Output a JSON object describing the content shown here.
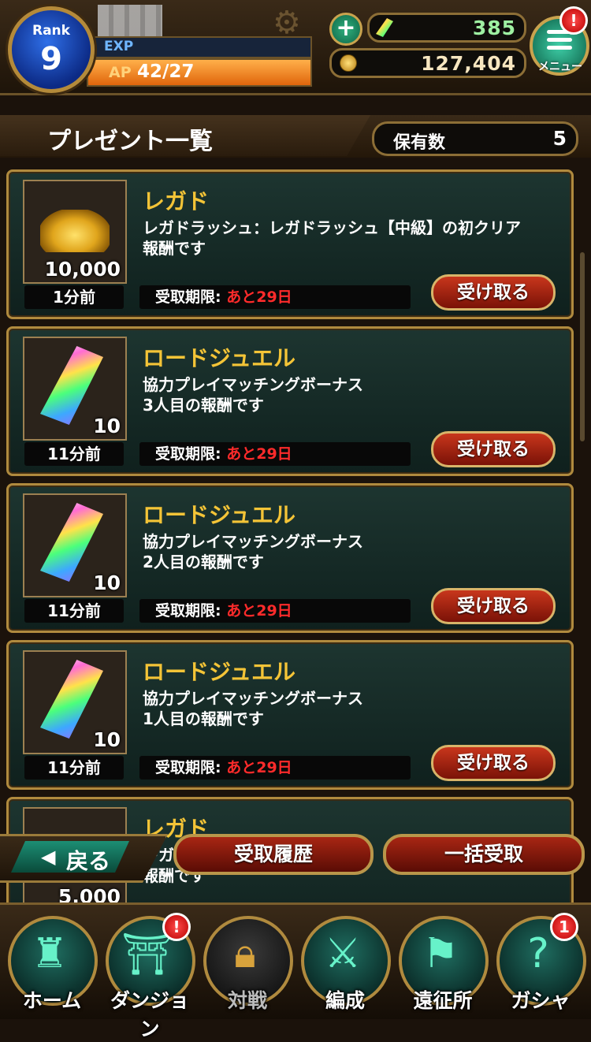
{
  "header": {
    "rank_label": "Rank",
    "rank_value": "9",
    "exp_label": "EXP",
    "ap_label": "AP",
    "ap_value": "42/27",
    "jewel_count": "385",
    "gold_count": "127,404",
    "menu_label": "メニュー",
    "menu_alert": "!"
  },
  "section": {
    "title": "プレゼント一覧",
    "count_label": "保有数",
    "count_value": "5"
  },
  "presents": [
    {
      "name": "レガド",
      "desc_line1": "レガドラッシュ：レガドラッシュ【中級】の初クリア",
      "desc_line2": "報酬です",
      "quantity": "10,000",
      "time_ago": "1分前",
      "deadline_label": "受取期限:",
      "deadline_value": "あと29日",
      "receive_label": "受け取る",
      "icon": "gold-coins-icon"
    },
    {
      "name": "ロードジュエル",
      "desc_line1": "協力プレイマッチングボーナス",
      "desc_line2": "3人目の報酬です",
      "quantity": "10",
      "time_ago": "11分前",
      "deadline_label": "受取期限:",
      "deadline_value": "あと29日",
      "receive_label": "受け取る",
      "icon": "jewel-icon"
    },
    {
      "name": "ロードジュエル",
      "desc_line1": "協力プレイマッチングボーナス",
      "desc_line2": "2人目の報酬です",
      "quantity": "10",
      "time_ago": "11分前",
      "deadline_label": "受取期限:",
      "deadline_value": "あと29日",
      "receive_label": "受け取る",
      "icon": "jewel-icon"
    },
    {
      "name": "ロードジュエル",
      "desc_line1": "協力プレイマッチングボーナス",
      "desc_line2": "1人目の報酬です",
      "quantity": "10",
      "time_ago": "11分前",
      "deadline_label": "受取期限:",
      "deadline_value": "あと29日",
      "receive_label": "受け取る",
      "icon": "jewel-icon"
    },
    {
      "name": "レガド",
      "desc_line1": "レガ",
      "desc_line2": "報酬です",
      "quantity": "5,000",
      "icon": "gold-coins-icon"
    }
  ],
  "actions": {
    "back_label": "戻る",
    "history_label": "受取履歴",
    "bulk_label": "一括受取"
  },
  "nav": [
    {
      "label": "ホーム",
      "icon": "castle-icon"
    },
    {
      "label": "ダンジョン",
      "icon": "dungeon-gate-icon",
      "badge": "!"
    },
    {
      "label": "対戦",
      "icon": "lock-icon"
    },
    {
      "label": "編成",
      "icon": "party-icon"
    },
    {
      "label": "遠征所",
      "icon": "flag-icon"
    },
    {
      "label": "ガシャ",
      "icon": "gacha-icon",
      "badge": "1"
    }
  ],
  "colors": {
    "accent_gold": "#f4c437",
    "deadline_red": "#ff2b2b",
    "jewel_green": "#9ef0a2"
  }
}
